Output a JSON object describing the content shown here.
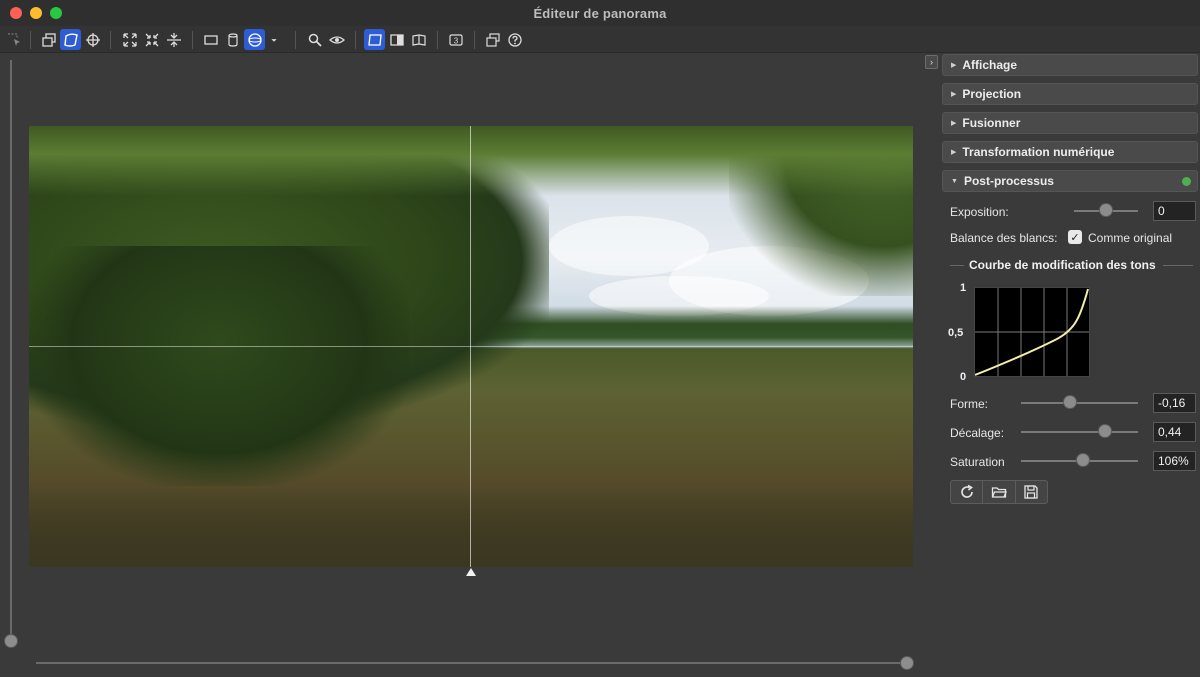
{
  "window": {
    "title": "Éditeur de panorama"
  },
  "toolbar": {
    "tools": [
      {
        "name": "select-tool-icon",
        "active": false
      },
      {
        "name": "layers-icon",
        "active": false
      },
      {
        "name": "warp-icon",
        "active": true
      },
      {
        "name": "center-target-icon",
        "active": false
      },
      {
        "name": "expand-icon",
        "active": false
      },
      {
        "name": "collapse-icon",
        "active": false
      },
      {
        "name": "split-vertical-icon",
        "active": false
      },
      {
        "name": "rectangle-projection-icon",
        "active": false
      },
      {
        "name": "cylinder-projection-icon",
        "active": false
      },
      {
        "name": "sphere-projection-icon",
        "active": true
      },
      {
        "name": "dropdown-icon",
        "active": false
      },
      {
        "name": "zoom-icon",
        "active": false
      },
      {
        "name": "preview-eye-icon",
        "active": false
      },
      {
        "name": "planar-view-icon",
        "active": true
      },
      {
        "name": "half-view-icon",
        "active": false
      },
      {
        "name": "book-view-icon",
        "active": false
      },
      {
        "name": "number-badge-icon",
        "active": false
      },
      {
        "name": "windows-icon",
        "active": false
      },
      {
        "name": "help-icon",
        "active": false
      }
    ],
    "badge_value": "3"
  },
  "panel": {
    "sections": [
      {
        "label": "Affichage",
        "expanded": false
      },
      {
        "label": "Projection",
        "expanded": false
      },
      {
        "label": "Fusionner",
        "expanded": false
      },
      {
        "label": "Transformation numérique",
        "expanded": false
      },
      {
        "label": "Post-processus",
        "expanded": true,
        "status_color": "#4caf50"
      }
    ],
    "post": {
      "exposure_label": "Exposition:",
      "exposure_value": "0",
      "exposure_slider": 0.5,
      "wb_label": "Balance des blancs:",
      "wb_checkbox_label": "Comme original",
      "wb_checked": true,
      "curve_title": "Courbe de modification des tons",
      "curve_ticks": [
        "1",
        "0,5",
        "0"
      ],
      "shape_label": "Forme:",
      "shape_value": "-0,16",
      "shape_slider": 0.42,
      "offset_label": "Décalage:",
      "offset_value": "0,44",
      "offset_slider": 0.72,
      "saturation_label": "Saturation",
      "saturation_value": "106%",
      "saturation_slider": 0.53
    },
    "actions": [
      "reset-icon",
      "open-folder-icon",
      "save-disk-icon"
    ]
  },
  "colors": {
    "accent": "#2d5cd4",
    "status_ok": "#4caf50",
    "curve": "#f3eeaa"
  }
}
